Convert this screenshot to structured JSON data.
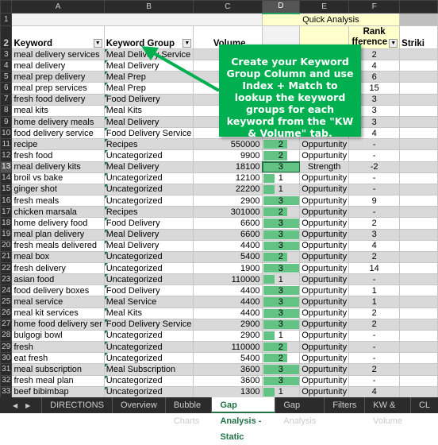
{
  "columns": [
    "A",
    "B",
    "C",
    "D",
    "E",
    "F",
    ""
  ],
  "row1": {
    "quick_analysis": "Quick Analysis"
  },
  "headers": {
    "keyword": "Keyword",
    "group": "Keyword Group",
    "volume": "Volume",
    "rank_diff_line1": "Rank",
    "rank_diff_line2": "fference",
    "striking": "Striki"
  },
  "rows": [
    {
      "n": 3,
      "kw": "meal delivery services",
      "grp": "Meal Delivery Service",
      "vol": "",
      "score": null,
      "type": "",
      "diff": "2"
    },
    {
      "n": 4,
      "kw": "meal delivery",
      "grp": "Meal Delivery",
      "vol": "",
      "score": null,
      "type": "",
      "diff": "4"
    },
    {
      "n": 5,
      "kw": "meal prep delivery",
      "grp": "Meal Prep",
      "vol": "",
      "score": null,
      "type": "",
      "diff": "6"
    },
    {
      "n": 6,
      "kw": "meal prep services",
      "grp": "Meal Prep",
      "vol": "",
      "score": null,
      "type": "",
      "diff": "15"
    },
    {
      "n": 7,
      "kw": "fresh food delivery",
      "grp": "Food Delivery",
      "vol": "",
      "score": null,
      "type": "",
      "diff": "3"
    },
    {
      "n": 8,
      "kw": "meal kits",
      "grp": "Meal Kits",
      "vol": "",
      "score": null,
      "type": "",
      "diff": "3"
    },
    {
      "n": 9,
      "kw": "home delivery meals",
      "grp": "Meal Delivery",
      "vol": "",
      "score": null,
      "type": "",
      "diff": "3"
    },
    {
      "n": 10,
      "kw": "food delivery service",
      "grp": "Food Delivery Service",
      "vol": "",
      "score": null,
      "type": "",
      "diff": "4"
    },
    {
      "n": 11,
      "kw": "recipe",
      "grp": "Recipes",
      "vol": "550000",
      "score": 2,
      "type": "Oppurtunity",
      "diff": "-"
    },
    {
      "n": 12,
      "kw": "fresh food",
      "grp": "Uncategorized",
      "vol": "9900",
      "score": 2,
      "type": "Oppurtunity",
      "diff": "-"
    },
    {
      "n": 13,
      "kw": "meal delivery kits",
      "grp": "Meal Delivery",
      "vol": "18100",
      "score": 3,
      "type": "Strength",
      "diff": "-2"
    },
    {
      "n": 14,
      "kw": "broil vs bake",
      "grp": "Uncategorized",
      "vol": "12100",
      "score": 1,
      "type": "Oppurtunity",
      "diff": "-"
    },
    {
      "n": 15,
      "kw": "ginger shot",
      "grp": "Uncategorized",
      "vol": "22200",
      "score": 1,
      "type": "Oppurtunity",
      "diff": "-"
    },
    {
      "n": 16,
      "kw": "fresh meals",
      "grp": "Uncategorized",
      "vol": "2900",
      "score": 3,
      "type": "Oppurtunity",
      "diff": "9"
    },
    {
      "n": 17,
      "kw": "chicken marsala",
      "grp": "Recipes",
      "vol": "301000",
      "score": 2,
      "type": "Oppurtunity",
      "diff": "-"
    },
    {
      "n": 18,
      "kw": "home delivery food",
      "grp": "Food Delivery",
      "vol": "6600",
      "score": 3,
      "type": "Oppurtunity",
      "diff": "2"
    },
    {
      "n": 19,
      "kw": "meal plan delivery",
      "grp": "Meal Delivery",
      "vol": "6600",
      "score": 3,
      "type": "Oppurtunity",
      "diff": "3"
    },
    {
      "n": 20,
      "kw": "fresh meals delivered",
      "grp": "Meal Delivery",
      "vol": "4400",
      "score": 3,
      "type": "Oppurtunity",
      "diff": "4"
    },
    {
      "n": 21,
      "kw": "meal box",
      "grp": "Uncategorized",
      "vol": "5400",
      "score": 2,
      "type": "Oppurtunity",
      "diff": "2"
    },
    {
      "n": 22,
      "kw": "fresh delivery",
      "grp": "Uncategorized",
      "vol": "1900",
      "score": 3,
      "type": "Oppurtunity",
      "diff": "14"
    },
    {
      "n": 23,
      "kw": "asian food",
      "grp": "Uncategorized",
      "vol": "110000",
      "score": 1,
      "type": "Oppurtunity",
      "diff": "-"
    },
    {
      "n": 24,
      "kw": "food delivery boxes",
      "grp": "Food Delivery",
      "vol": "4400",
      "score": 3,
      "type": "Oppurtunity",
      "diff": "1"
    },
    {
      "n": 25,
      "kw": "meal service",
      "grp": "Meal Service",
      "vol": "4400",
      "score": 3,
      "type": "Oppurtunity",
      "diff": "1"
    },
    {
      "n": 26,
      "kw": "meal kit services",
      "grp": "Meal Kits",
      "vol": "4400",
      "score": 3,
      "type": "Oppurtunity",
      "diff": "2"
    },
    {
      "n": 27,
      "kw": "home food delivery ser",
      "grp": "Food Delivery Service",
      "vol": "2900",
      "score": 3,
      "type": "Oppurtunity",
      "diff": "2"
    },
    {
      "n": 28,
      "kw": "bulgogi bowl",
      "grp": "Uncategorized",
      "vol": "2900",
      "score": 1,
      "type": "Oppurtunity",
      "diff": "-"
    },
    {
      "n": 29,
      "kw": "fresh",
      "grp": "Uncategorized",
      "vol": "110000",
      "score": 2,
      "type": "Oppurtunity",
      "diff": "-"
    },
    {
      "n": 30,
      "kw": "eat fresh",
      "grp": "Uncategorized",
      "vol": "5400",
      "score": 2,
      "type": "Oppurtunity",
      "diff": "-"
    },
    {
      "n": 31,
      "kw": "meal subscription",
      "grp": "Meal Subscription",
      "vol": "3600",
      "score": 3,
      "type": "Oppurtunity",
      "diff": "2"
    },
    {
      "n": 32,
      "kw": "fresh meal plan",
      "grp": "Uncategorized",
      "vol": "3600",
      "score": 3,
      "type": "Oppurtunity",
      "diff": "-"
    },
    {
      "n": 33,
      "kw": "beef bibimbap",
      "grp": "Uncategorized",
      "vol": "1300",
      "score": 1,
      "type": "Oppurtunity",
      "diff": "4"
    }
  ],
  "callout": {
    "text": "Create your Keyword Group Column and use Index + Match to lookup the keyword groups for each keyword from the \"KW & Volume\" tab.",
    "color": "#00b050"
  },
  "tabs": [
    "DIRECTIONS",
    "Overview",
    "Bubble Charts",
    "Gap Analysis - Static",
    "Gap Analysis",
    "Filters",
    "KW & Volume",
    "CL"
  ],
  "active_tab": "Gap Analysis - Static",
  "databar_color": "#63c384"
}
